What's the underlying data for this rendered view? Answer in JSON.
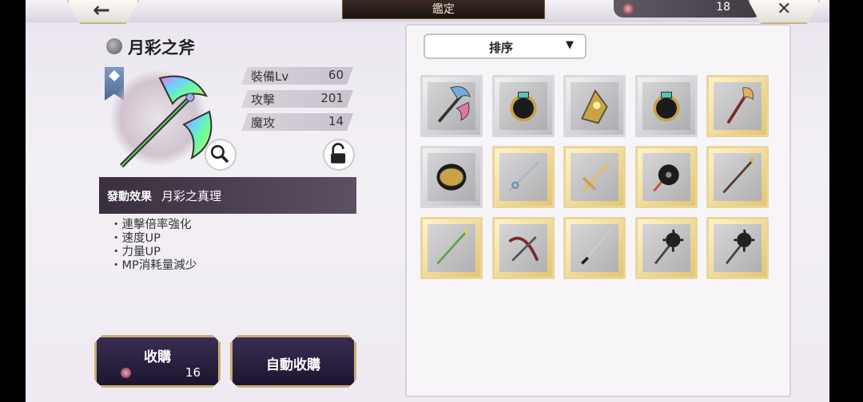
{
  "header": {
    "title": "鑑定",
    "back_icon": "back-arrow-icon",
    "close_icon": "close-icon",
    "currency": {
      "icon": "coin-icon",
      "value": "18"
    }
  },
  "item": {
    "name": "月彩之斧",
    "stats": [
      {
        "label": "裝備Lv",
        "value": "60"
      },
      {
        "label": "攻擊",
        "value": "201"
      },
      {
        "label": "魔攻",
        "value": "14"
      }
    ],
    "effect_label": "發動效果",
    "effect_name": "月彩之真理",
    "effects": [
      "連擊倍率強化",
      "速度UP",
      "力量UP",
      "MP消耗量減少"
    ]
  },
  "actions": {
    "buy_label": "收購",
    "buy_cost": "16",
    "auto_buy_label": "自動收購"
  },
  "sort": {
    "label": "排序"
  },
  "grid": [
    {
      "name": "rainbow-axe",
      "frame": "silver"
    },
    {
      "name": "black-ring",
      "frame": "silver"
    },
    {
      "name": "gold-gauntlet",
      "frame": "silver"
    },
    {
      "name": "black-ring",
      "frame": "silver"
    },
    {
      "name": "red-axe",
      "frame": "gold"
    },
    {
      "name": "gold-bracelet",
      "frame": "silver"
    },
    {
      "name": "rapier",
      "frame": "gold"
    },
    {
      "name": "gold-sword",
      "frame": "gold"
    },
    {
      "name": "spiked-flail",
      "frame": "gold"
    },
    {
      "name": "spear",
      "frame": "gold"
    },
    {
      "name": "green-spear",
      "frame": "gold"
    },
    {
      "name": "crossbow",
      "frame": "gold"
    },
    {
      "name": "katana",
      "frame": "gold"
    },
    {
      "name": "morning-star",
      "frame": "gold"
    },
    {
      "name": "morning-star",
      "frame": "gold"
    }
  ],
  "colors": {
    "gold_frame": "#ead59a",
    "silver_frame": "#d9d9dd",
    "panel_dark": "#3a2f3e"
  }
}
